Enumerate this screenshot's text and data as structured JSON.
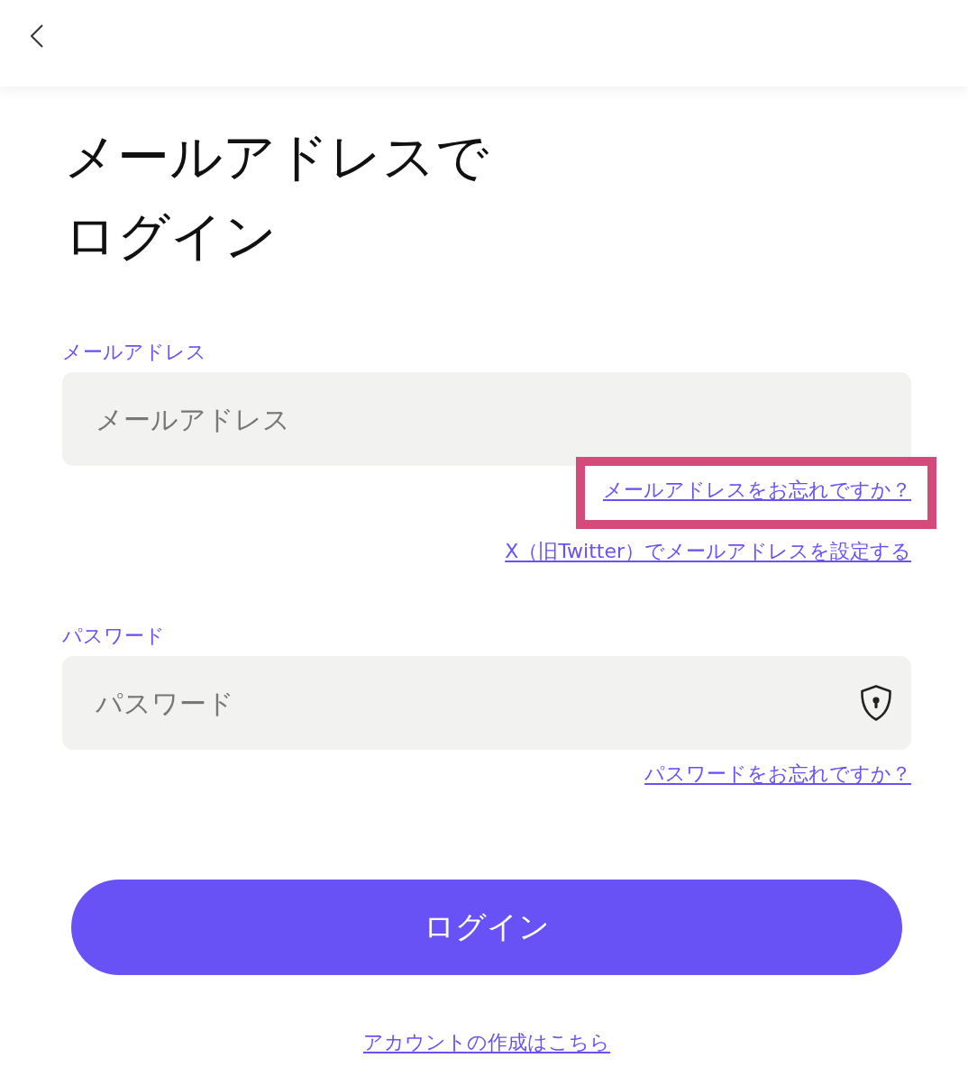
{
  "title_lines": [
    "メールアドレスで",
    "ログイン"
  ],
  "fields": [
    {
      "kind": "email",
      "label": "メールアドレス",
      "placeholder": "メールアドレス",
      "links": [
        {
          "text": "メールアドレスをお忘れですか？",
          "highlighted": true
        },
        {
          "text": "X（旧Twitter）でメールアドレスを設定する",
          "highlighted": false
        }
      ]
    },
    {
      "kind": "password",
      "label": "パスワード",
      "placeholder": "パスワード",
      "links": [
        {
          "text": "パスワードをお忘れですか？",
          "highlighted": false
        }
      ]
    }
  ],
  "login_button": "ログイン",
  "signup_link": "アカウントの作成はこちら"
}
